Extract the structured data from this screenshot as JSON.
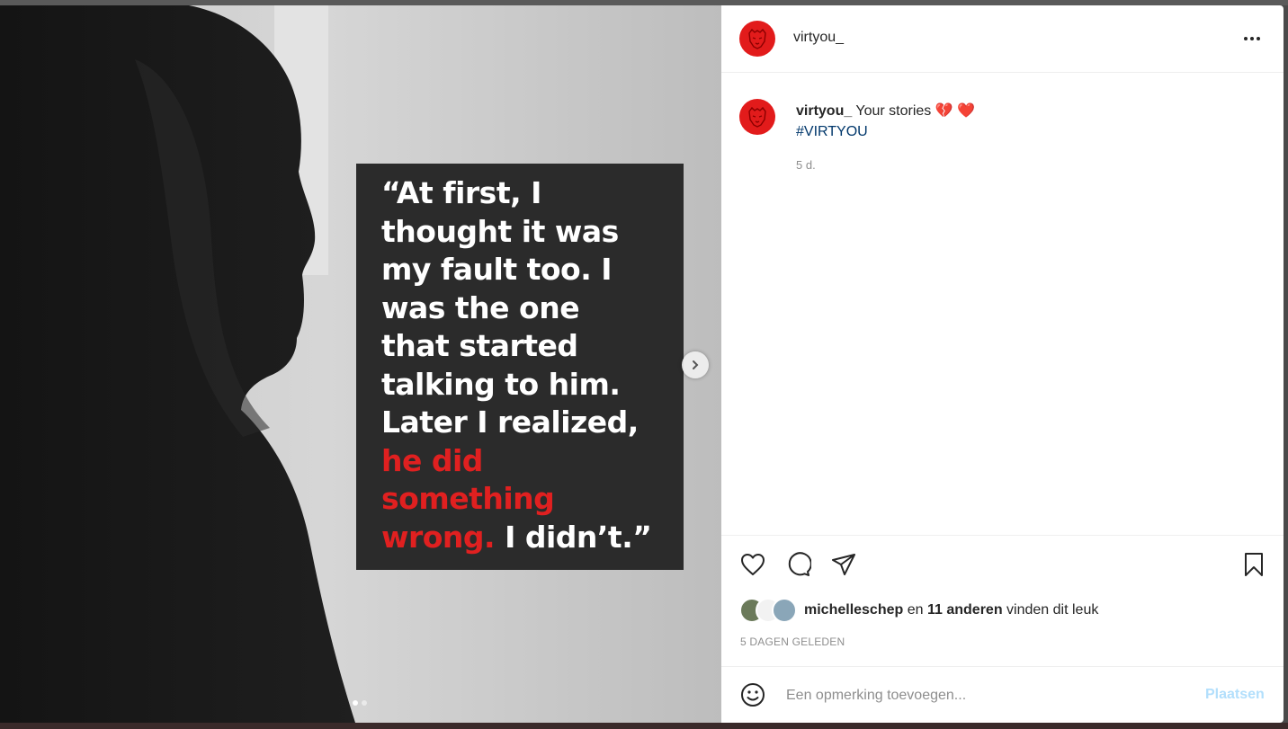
{
  "post": {
    "username": "virtyou_",
    "more_label": "•••",
    "slide_count": 2,
    "active_slide": 1
  },
  "quote": {
    "line1": "“At first, I",
    "line2": "thought it was",
    "line3": "my fault too. I",
    "line4": "was the one",
    "line5": "that started",
    "line6": "talking to him.",
    "line7": "Later I realized,",
    "red1": "he did",
    "red2": "something",
    "red3": "wrong.",
    "end": " I didn’t.”"
  },
  "caption": {
    "username": "virtyou_",
    "text": "Your stories",
    "emojis": "💔 ❤️",
    "hashtag": "#VIRTYOU",
    "time": "5 d."
  },
  "likes": {
    "user": "michelleschep",
    "joiner": "en",
    "others": "11 anderen",
    "suffix": "vinden dit leuk"
  },
  "post_age": "5 DAGEN GELEDEN",
  "comment": {
    "placeholder": "Een opmerking toevoegen...",
    "submit_label": "Plaatsen"
  },
  "colors": {
    "brand_red": "#e21b1b",
    "link_blue": "#00376b",
    "post_button_disabled": "#b2dffc"
  },
  "icons": [
    "heart-icon",
    "comment-icon",
    "share-icon",
    "bookmark-icon",
    "emoji-icon",
    "more-icon",
    "chevron-right-icon"
  ]
}
